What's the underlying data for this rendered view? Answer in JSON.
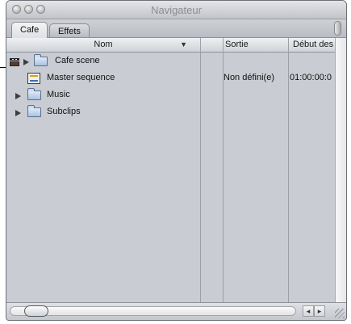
{
  "window": {
    "title": "Navigateur"
  },
  "tabs": [
    {
      "label": "Cafe",
      "active": true
    },
    {
      "label": "Effets",
      "active": false
    }
  ],
  "columns": {
    "name": "Nom",
    "output": "Sortie",
    "start": "Début des"
  },
  "rows": [
    {
      "icon": "folder-icon",
      "expandable": true,
      "name": "Cafe scene",
      "output": "",
      "start": ""
    },
    {
      "icon": "sequence-icon",
      "expandable": false,
      "name": "Master sequence",
      "output": "Non défini(e)",
      "start": "01:00:00:0"
    },
    {
      "icon": "folder-icon",
      "expandable": true,
      "name": "Music",
      "output": "",
      "start": ""
    },
    {
      "icon": "folder-icon",
      "expandable": true,
      "name": "Subclips",
      "output": "",
      "start": ""
    }
  ],
  "scrollbar": {
    "left_arrow": "◂",
    "right_arrow": "▸"
  },
  "colors": {
    "panel_bg": "#c9ccd2",
    "title_text": "#8a8d94",
    "folder_blue": "#a9c2e2"
  }
}
